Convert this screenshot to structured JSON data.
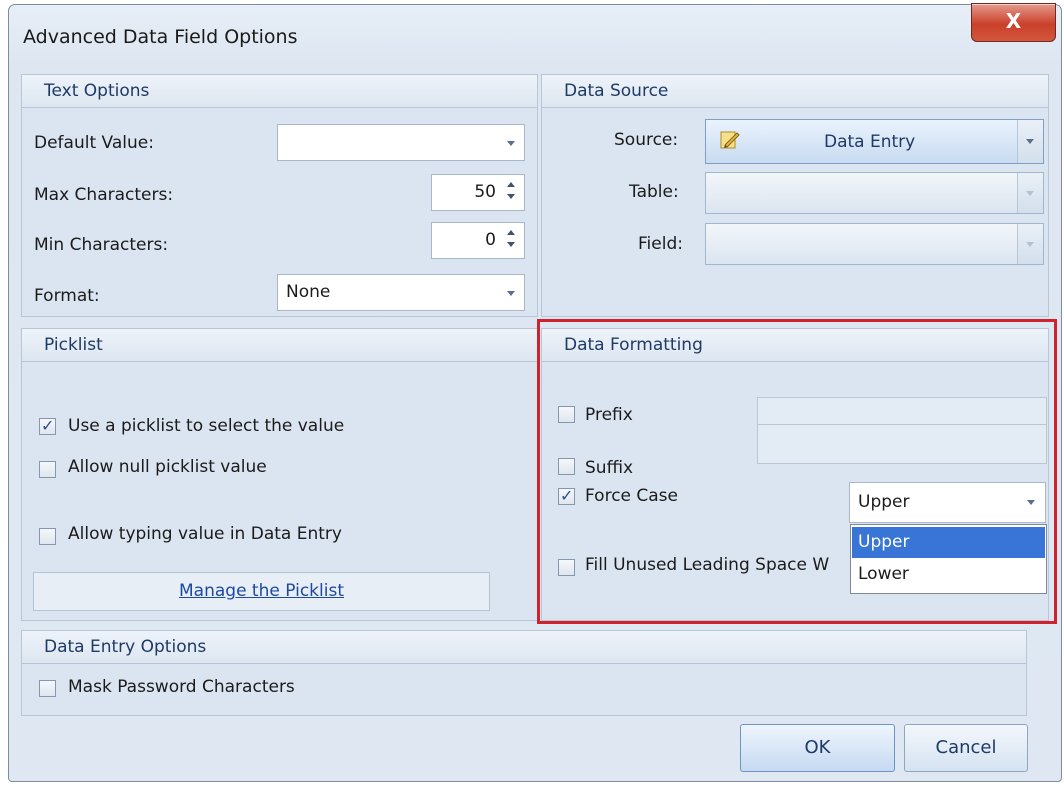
{
  "window": {
    "title": "Advanced Data Field Options",
    "close_glyph": "X"
  },
  "text_options": {
    "header": "Text Options",
    "default_value_label": "Default Value:",
    "default_value": "",
    "max_chars_label": "Max Characters:",
    "max_chars": "50",
    "min_chars_label": "Min Characters:",
    "min_chars": "0",
    "format_label": "Format:",
    "format": "None"
  },
  "data_source": {
    "header": "Data Source",
    "source_label": "Source:",
    "source": "Data Entry",
    "source_icon": "pencil-icon",
    "table_label": "Table:",
    "table": "",
    "field_label": "Field:",
    "field": ""
  },
  "picklist": {
    "header": "Picklist",
    "use_picklist_label": "Use a picklist to select the value",
    "use_picklist": true,
    "allow_null_label": "Allow null picklist value",
    "allow_null": false,
    "allow_typing_label": "Allow typing value in Data Entry",
    "allow_typing": false,
    "manage_link": "Manage the Picklist"
  },
  "data_formatting": {
    "header": "Data Formatting",
    "prefix_label": "Prefix",
    "prefix": false,
    "suffix_label": "Suffix",
    "suffix": false,
    "force_case_label": "Force Case",
    "force_case": true,
    "force_case_value": "Upper",
    "force_case_options": [
      "Upper",
      "Lower"
    ],
    "fill_label": "Fill Unused Leading Space W",
    "fill": false
  },
  "data_entry_options": {
    "header": "Data Entry Options",
    "mask_label": "Mask Password Characters",
    "mask": false
  },
  "buttons": {
    "ok": "OK",
    "cancel": "Cancel"
  },
  "colors": {
    "highlight_box": "#d0222b",
    "selected_option": "#3875d7",
    "header_text": "#1f3a66"
  }
}
